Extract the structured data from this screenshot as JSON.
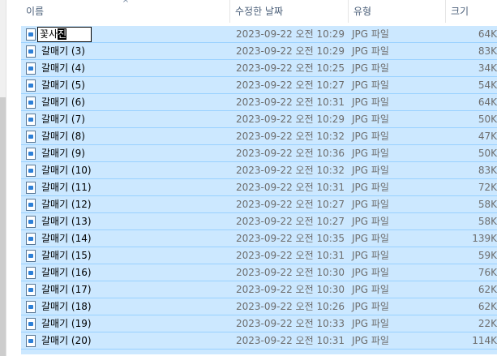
{
  "columns": {
    "name": "이름",
    "date": "수정한 날짜",
    "type": "유형",
    "size": "크기"
  },
  "sort_indicator": "^",
  "rename": {
    "prefix": "꽃사",
    "selected": "진"
  },
  "rows": [
    {
      "name": "",
      "date": "2023-09-22 오전 10:29",
      "type": "JPG 파일",
      "size": "64K"
    },
    {
      "name": "갈매기 (3)",
      "date": "2023-09-22 오전 10:29",
      "type": "JPG 파일",
      "size": "83K"
    },
    {
      "name": "갈매기 (4)",
      "date": "2023-09-22 오전 10:25",
      "type": "JPG 파일",
      "size": "34K"
    },
    {
      "name": "갈매기 (5)",
      "date": "2023-09-22 오전 10:27",
      "type": "JPG 파일",
      "size": "54K"
    },
    {
      "name": "갈매기 (6)",
      "date": "2023-09-22 오전 10:31",
      "type": "JPG 파일",
      "size": "64K"
    },
    {
      "name": "갈매기 (7)",
      "date": "2023-09-22 오전 10:29",
      "type": "JPG 파일",
      "size": "50K"
    },
    {
      "name": "갈매기 (8)",
      "date": "2023-09-22 오전 10:32",
      "type": "JPG 파일",
      "size": "47K"
    },
    {
      "name": "갈매기 (9)",
      "date": "2023-09-22 오전 10:36",
      "type": "JPG 파일",
      "size": "50K"
    },
    {
      "name": "갈매기 (10)",
      "date": "2023-09-22 오전 10:32",
      "type": "JPG 파일",
      "size": "83K"
    },
    {
      "name": "갈매기 (11)",
      "date": "2023-09-22 오전 10:31",
      "type": "JPG 파일",
      "size": "72K"
    },
    {
      "name": "갈매기 (12)",
      "date": "2023-09-22 오전 10:27",
      "type": "JPG 파일",
      "size": "58K"
    },
    {
      "name": "갈매기 (13)",
      "date": "2023-09-22 오전 10:27",
      "type": "JPG 파일",
      "size": "58K"
    },
    {
      "name": "갈매기 (14)",
      "date": "2023-09-22 오전 10:35",
      "type": "JPG 파일",
      "size": "139K"
    },
    {
      "name": "갈매기 (15)",
      "date": "2023-09-22 오전 10:31",
      "type": "JPG 파일",
      "size": "59K"
    },
    {
      "name": "갈매기 (16)",
      "date": "2023-09-22 오전 10:30",
      "type": "JPG 파일",
      "size": "76K"
    },
    {
      "name": "갈매기 (17)",
      "date": "2023-09-22 오전 10:30",
      "type": "JPG 파일",
      "size": "62K"
    },
    {
      "name": "갈매기 (18)",
      "date": "2023-09-22 오전 10:26",
      "type": "JPG 파일",
      "size": "62K"
    },
    {
      "name": "갈매기 (19)",
      "date": "2023-09-22 오전 10:33",
      "type": "JPG 파일",
      "size": "22K"
    },
    {
      "name": "갈매기 (20)",
      "date": "2023-09-22 오전 10:31",
      "type": "JPG 파일",
      "size": "114K"
    }
  ],
  "colors": {
    "selection_bg": "#cce8ff",
    "selection_border": "#99d1ff",
    "header_text": "#4c607a",
    "meta_text": "#6d6d6d"
  }
}
